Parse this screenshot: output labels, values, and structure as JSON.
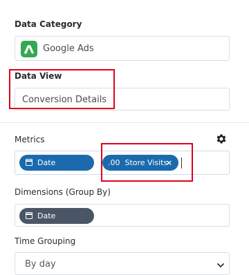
{
  "data_category": {
    "label": "Data Category",
    "value": "Google Ads",
    "icon": "google-ads-icon"
  },
  "data_view": {
    "label": "Data View",
    "value": "Conversion Details"
  },
  "metrics": {
    "label": "Metrics",
    "settings_icon": "gear-icon",
    "chips": [
      {
        "label": "Date",
        "icon": "calendar-icon"
      },
      {
        "label": ".00  Store Visits",
        "remove": "×"
      }
    ]
  },
  "dimensions": {
    "label": "Dimensions (Group By)",
    "chips": [
      {
        "label": "Date",
        "icon": "calendar-icon"
      }
    ]
  },
  "time_grouping": {
    "label": "Time Grouping",
    "value": "By day"
  },
  "colors": {
    "chip_blue": "#1b6aae",
    "chip_dark": "#4a5666",
    "highlight": "#e0001b",
    "google_ads_green": "#34a853"
  }
}
